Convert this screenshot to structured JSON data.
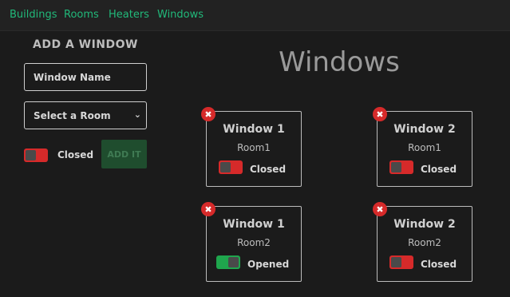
{
  "nav": {
    "items": [
      "Buildings",
      "Rooms",
      "Heaters",
      "Windows"
    ]
  },
  "form": {
    "title": "ADD A WINDOW",
    "name_placeholder": "Window Name",
    "room_select": "Select a Room",
    "state_label": "Closed",
    "submit_label": "ADD IT"
  },
  "page": {
    "title": "Windows"
  },
  "windows": [
    {
      "name": "Window 1",
      "room": "Room1",
      "state": "Closed",
      "open": false
    },
    {
      "name": "Window 2",
      "room": "Room1",
      "state": "Closed",
      "open": false
    },
    {
      "name": "Window 1",
      "room": "Room2",
      "state": "Opened",
      "open": true
    },
    {
      "name": "Window 2",
      "room": "Room2",
      "state": "Closed",
      "open": false
    }
  ],
  "icons": {
    "delete": "close-icon",
    "dropdown": "chevron-down-icon"
  },
  "colors": {
    "accent": "#21b97a",
    "closed": "#d62a2a",
    "opened": "#1fa64d"
  }
}
